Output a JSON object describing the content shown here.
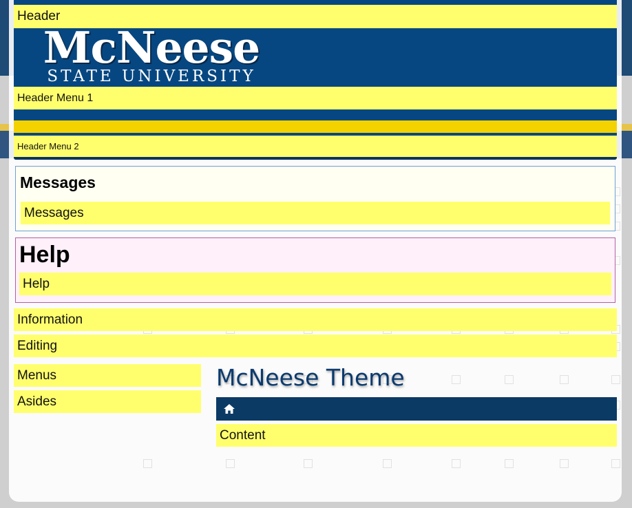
{
  "regions": {
    "header": "Header",
    "header_menu_1": "Header Menu 1",
    "header_menu_2": "Header Menu 2",
    "messages_heading": "Messages",
    "messages": "Messages",
    "help_heading": "Help",
    "help": "Help",
    "information": "Information",
    "editing": "Editing",
    "menus": "Menus",
    "asides": "Asides",
    "content": "Content"
  },
  "logo": {
    "main": "McNeese",
    "sub": "STATE UNIVERSITY"
  },
  "page_title": "McNeese Theme",
  "breadcrumb": {
    "icon": "home-icon"
  },
  "colors": {
    "region_highlight": "#ffff6e",
    "header_blue": "#074781",
    "gold": "#f3d200",
    "title_blue": "#0b3a6e",
    "breadcrumb_bg": "#0b3a64",
    "messages_bg": "#fffff2",
    "help_bg": "#fff0fa"
  }
}
